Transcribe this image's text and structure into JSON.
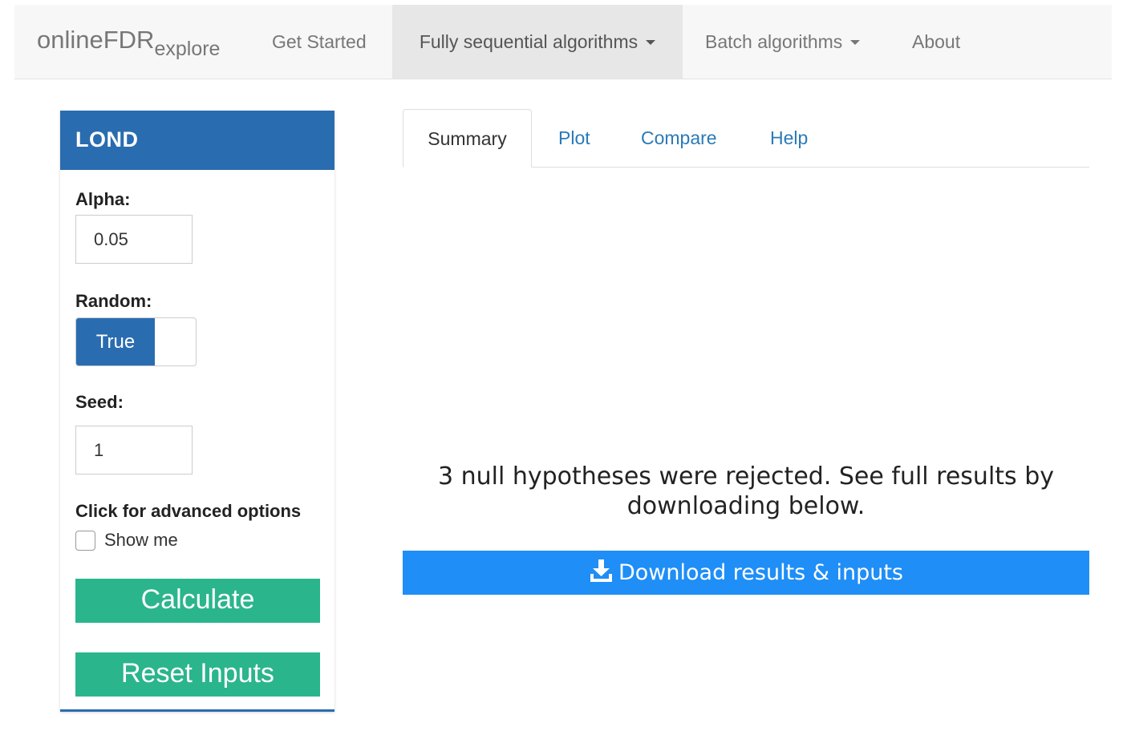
{
  "navbar": {
    "brand_main": "onlineFDR",
    "brand_sub": "explore",
    "items": [
      {
        "label": "Get Started"
      },
      {
        "label": "Fully sequential algorithms"
      },
      {
        "label": "Batch algorithms"
      },
      {
        "label": "About"
      }
    ],
    "active_index": 1
  },
  "sidebar": {
    "title": "LOND",
    "alpha_label": "Alpha:",
    "alpha_value": "0.05",
    "random_label": "Random:",
    "random_value": "True",
    "seed_label": "Seed:",
    "seed_value": "1",
    "advanced_label": "Click for advanced options",
    "show_me_label": "Show me",
    "show_me_checked": false,
    "calculate_label": "Calculate",
    "reset_label": "Reset Inputs"
  },
  "tabs": [
    {
      "label": "Summary"
    },
    {
      "label": "Plot"
    },
    {
      "label": "Compare"
    },
    {
      "label": "Help"
    }
  ],
  "active_tab": "Summary",
  "main": {
    "summary_line1": "3 null hypotheses were rejected. See full results by",
    "summary_line2": "downloading below.",
    "download_label": "Download results & inputs",
    "download_icon": "download-icon"
  },
  "colors": {
    "header_blue": "#2a6cb0",
    "green_button": "#2bb58c",
    "download_blue": "#1f8ef6",
    "tab_link": "#2a7ab8"
  }
}
